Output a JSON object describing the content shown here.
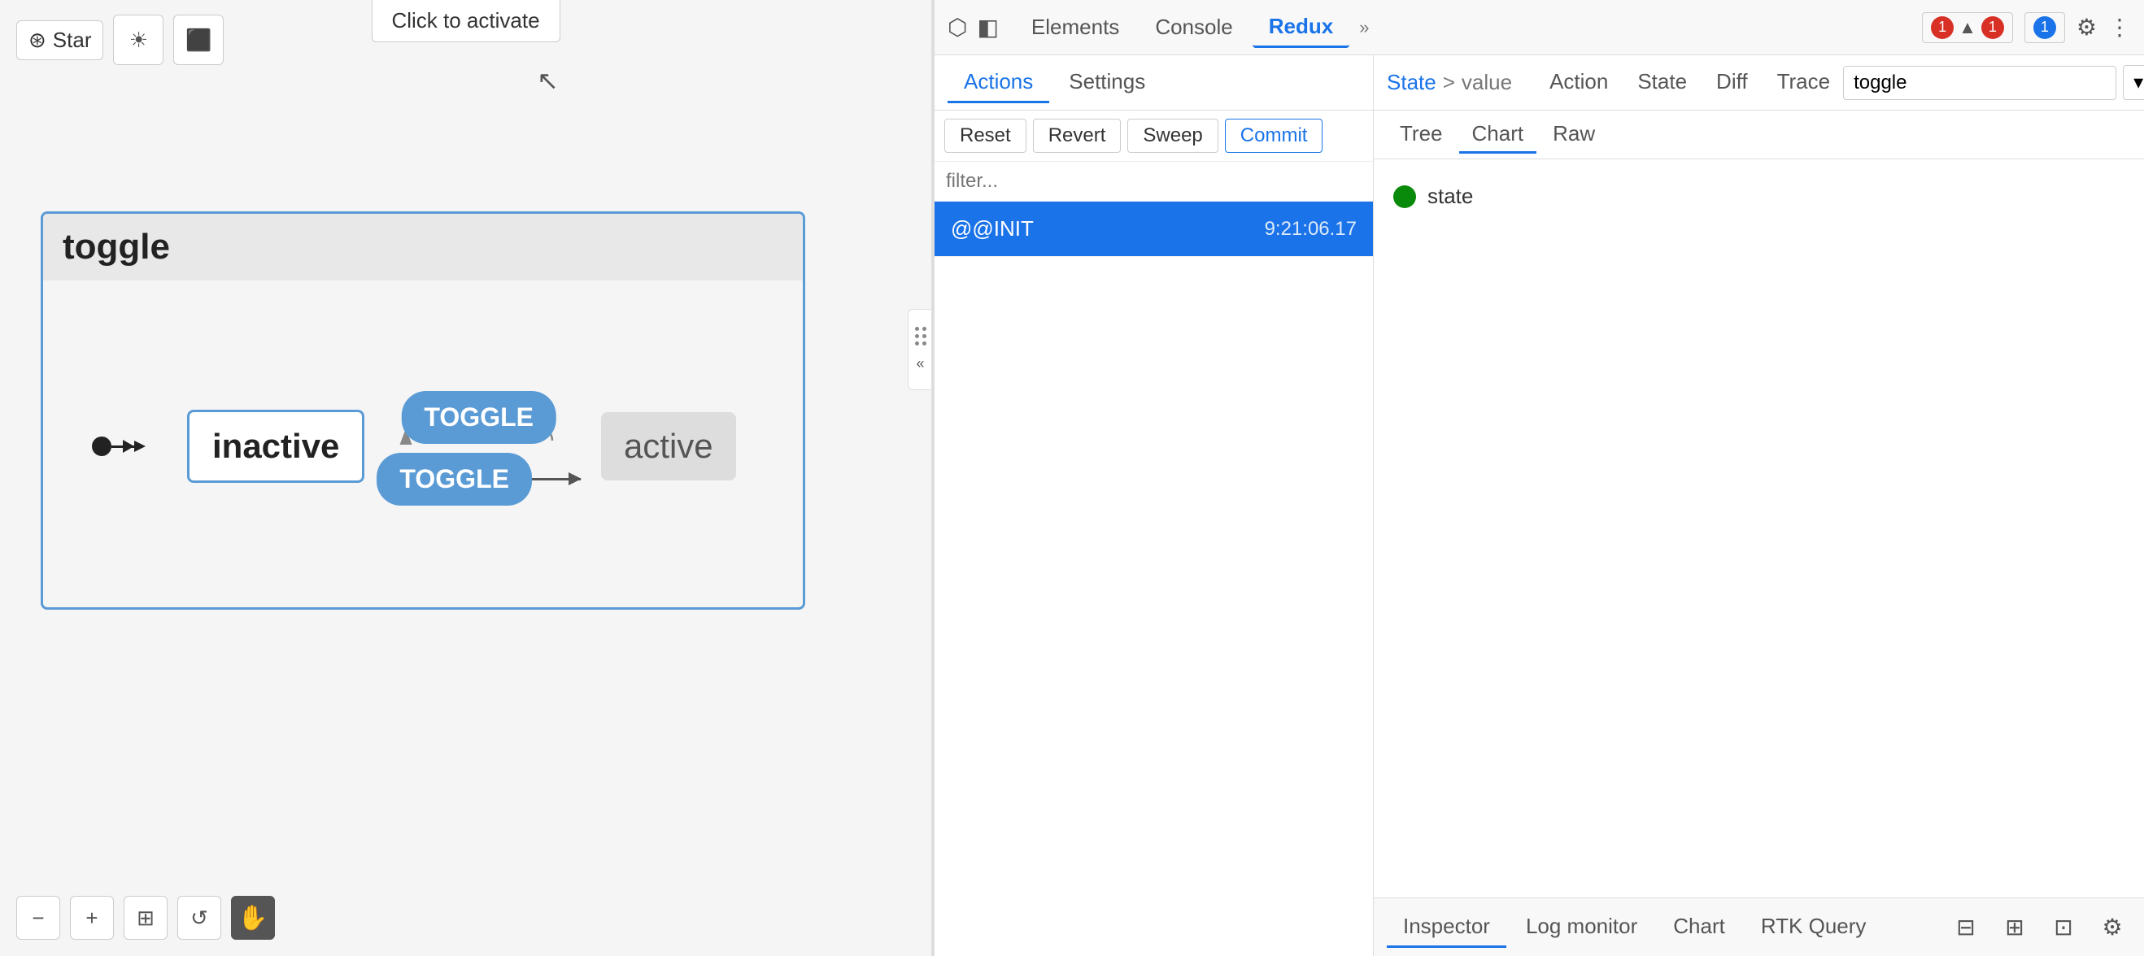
{
  "app": {
    "star_label": "Star",
    "click_to_activate": "Click to activate"
  },
  "toolbar": {
    "sun_icon": "☀",
    "camera_icon": "📷",
    "minus_label": "−",
    "plus_label": "+",
    "fit_label": "⊞",
    "rotate_label": "↺",
    "hand_label": "✋"
  },
  "diagram": {
    "title": "toggle",
    "initial_state": "inactive",
    "final_state": "active",
    "toggle_label": "TOGGLE",
    "transition_label": "TOGGLE"
  },
  "devtools": {
    "tabs": [
      {
        "label": "Elements",
        "active": false
      },
      {
        "label": "Console",
        "active": false
      },
      {
        "label": "Redux",
        "active": true
      }
    ],
    "more_label": "»",
    "error_count": "1",
    "warning_count": "1",
    "message_count": "1",
    "settings_icon": "⚙",
    "more_options_icon": "⋮"
  },
  "redux": {
    "tabs": [
      {
        "label": "Actions",
        "active": true
      },
      {
        "label": "Settings",
        "active": false
      }
    ],
    "buttons": [
      {
        "label": "Reset"
      },
      {
        "label": "Revert"
      },
      {
        "label": "Sweep"
      },
      {
        "label": "Commit"
      }
    ],
    "filter_placeholder": "filter...",
    "actions": [
      {
        "name": "@@INIT",
        "time": "9:21:06.17"
      }
    ]
  },
  "inspector": {
    "breadcrumb": {
      "link": "State",
      "separator": ">",
      "current": "value"
    },
    "tabs": [
      {
        "label": "Action",
        "active": false
      },
      {
        "label": "State",
        "active": false
      },
      {
        "label": "Diff",
        "active": false
      },
      {
        "label": "Trace",
        "active": false
      }
    ],
    "view_tabs": [
      {
        "label": "Tree",
        "active": false
      },
      {
        "label": "Chart",
        "active": true
      },
      {
        "label": "Raw",
        "active": false
      }
    ],
    "search_placeholder": "toggle",
    "state_label": "state",
    "state_dot_color": "#0a8a0a"
  },
  "bottom_tabs": [
    {
      "label": "Inspector",
      "active": true
    },
    {
      "label": "Log monitor",
      "active": false
    },
    {
      "label": "Chart",
      "active": false
    },
    {
      "label": "RTK Query",
      "active": false
    }
  ]
}
